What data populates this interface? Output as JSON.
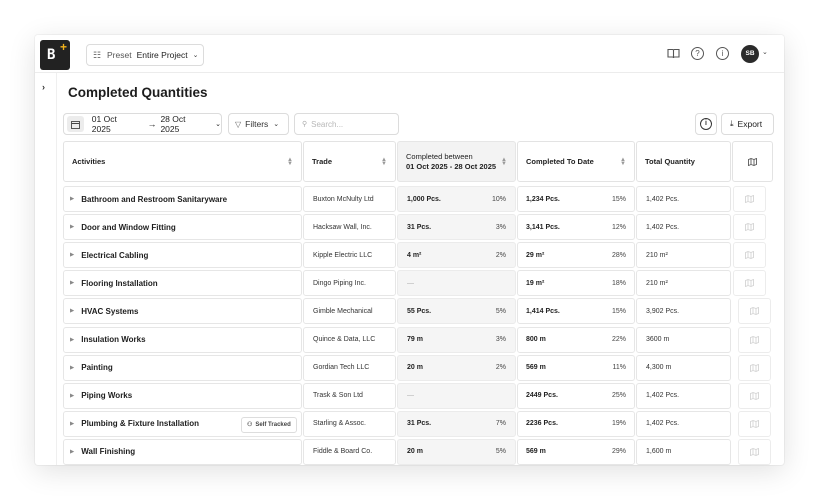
{
  "app": {
    "logo_text": "B",
    "preset": {
      "label": "Preset",
      "value": "Entire Project"
    },
    "user_initials": "SB"
  },
  "page": {
    "title": "Completed Quantities"
  },
  "toolbar": {
    "date_from": "01 Oct 2025",
    "date_to": "28 Oct 2025",
    "filters_label": "Filters",
    "search_placeholder": "Search...",
    "export_label": "Export"
  },
  "table": {
    "headers": {
      "activities": "Activities",
      "trade": "Trade",
      "completed_between_line1": "Completed between",
      "completed_between_line2": "01 Oct 2025 - 28 Oct 2025",
      "completed_to_date": "Completed To Date",
      "total_quantity": "Total Quantity"
    },
    "badge_self_tracked": "Self Tracked",
    "rows": [
      {
        "activity": "Bathroom and Restroom Sanitaryware",
        "trade": "Buxton McNulty Ltd",
        "between_qty": "1,000 Pcs.",
        "between_pct": "10%",
        "to_date_qty": "1,234 Pcs.",
        "to_date_pct": "15%",
        "total": "1,402 Pcs.",
        "self_tracked": false
      },
      {
        "activity": "Door and Window Fitting",
        "trade": "Hacksaw Wall, Inc.",
        "between_qty": "31 Pcs.",
        "between_pct": "3%",
        "to_date_qty": "3,141 Pcs.",
        "to_date_pct": "12%",
        "total": "1,402 Pcs.",
        "self_tracked": false
      },
      {
        "activity": "Electrical Cabling",
        "trade": "Kipple Electric LLC",
        "between_qty": "4 m²",
        "between_pct": "2%",
        "to_date_qty": "29 m²",
        "to_date_pct": "28%",
        "total": "210 m²",
        "self_tracked": false
      },
      {
        "activity": "Flooring Installation",
        "trade": "Dingo Piping Inc.",
        "between_qty": "—",
        "between_pct": "",
        "to_date_qty": "19 m²",
        "to_date_pct": "18%",
        "total": "210 m²",
        "self_tracked": false
      },
      {
        "activity": "HVAC Systems",
        "trade": "Gimble Mechanical",
        "between_qty": "55 Pcs.",
        "between_pct": "5%",
        "to_date_qty": "1,414 Pcs.",
        "to_date_pct": "15%",
        "total": "3,902 Pcs.",
        "self_tracked": false
      },
      {
        "activity": "Insulation Works",
        "trade": "Quince & Data, LLC",
        "between_qty": "79 m",
        "between_pct": "3%",
        "to_date_qty": "800 m",
        "to_date_pct": "22%",
        "total": "3600 m",
        "self_tracked": false
      },
      {
        "activity": "Painting",
        "trade": "Gordian Tech LLC",
        "between_qty": "20 m",
        "between_pct": "2%",
        "to_date_qty": "569 m",
        "to_date_pct": "11%",
        "total": "4,300 m",
        "self_tracked": false
      },
      {
        "activity": "Piping Works",
        "trade": "Trask & Son Ltd",
        "between_qty": "—",
        "between_pct": "",
        "to_date_qty": "2449 Pcs.",
        "to_date_pct": "25%",
        "total": "1,402 Pcs.",
        "self_tracked": false
      },
      {
        "activity": "Plumbing & Fixture Installation",
        "trade": "Starling & Assoc.",
        "between_qty": "31 Pcs.",
        "between_pct": "7%",
        "to_date_qty": "2236 Pcs.",
        "to_date_pct": "19%",
        "total": "1,402 Pcs.",
        "self_tracked": true
      },
      {
        "activity": "Wall Finishing",
        "trade": "Fiddle & Board Co.",
        "between_qty": "20 m",
        "between_pct": "5%",
        "to_date_qty": "569 m",
        "to_date_pct": "29%",
        "total": "1,600 m",
        "self_tracked": false
      }
    ]
  },
  "colors": {
    "accent_logo": "#f2b21c",
    "logo_bg": "#222222",
    "shaded_column": "#f5f5f5"
  }
}
